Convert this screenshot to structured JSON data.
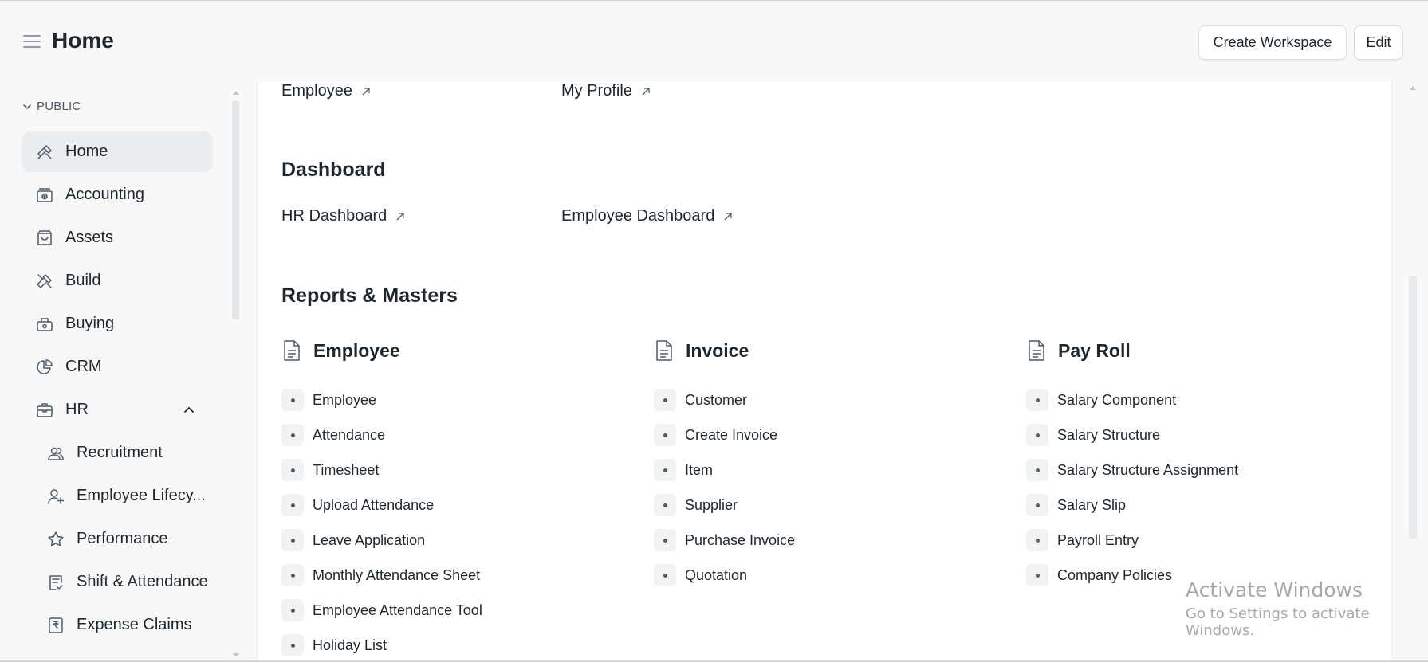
{
  "header": {
    "title": "Home",
    "create_workspace": "Create Workspace",
    "edit": "Edit"
  },
  "sidebar": {
    "section": "PUBLIC",
    "items": [
      {
        "label": "Home",
        "icon": "tools-icon"
      },
      {
        "label": "Accounting",
        "icon": "accounting-icon"
      },
      {
        "label": "Assets",
        "icon": "bag-icon"
      },
      {
        "label": "Build",
        "icon": "hammer-icon"
      },
      {
        "label": "Buying",
        "icon": "buying-icon"
      },
      {
        "label": "CRM",
        "icon": "pie-chart-icon"
      },
      {
        "label": "HR",
        "icon": "briefcase-icon"
      },
      {
        "label": "Recruitment",
        "icon": "users-icon"
      },
      {
        "label": "Employee Lifecy...",
        "icon": "user-plus-icon"
      },
      {
        "label": "Performance",
        "icon": "star-icon"
      },
      {
        "label": "Shift & Attendance",
        "icon": "clipboard-check-icon"
      },
      {
        "label": "Expense Claims",
        "icon": "rupee-receipt-icon"
      }
    ]
  },
  "main": {
    "top_links": [
      "Employee",
      "My Profile"
    ],
    "dashboard": {
      "title": "Dashboard",
      "links": [
        "HR Dashboard",
        "Employee Dashboard"
      ]
    },
    "reports": {
      "title": "Reports & Masters",
      "cards": [
        {
          "title": "Employee",
          "items": [
            "Employee",
            "Attendance",
            "Timesheet",
            "Upload Attendance",
            "Leave Application",
            "Monthly Attendance Sheet",
            "Employee Attendance Tool",
            "Holiday List"
          ]
        },
        {
          "title": "Invoice",
          "items": [
            "Customer",
            "Create Invoice",
            "Item",
            "Supplier",
            "Purchase Invoice",
            "Quotation"
          ]
        },
        {
          "title": "Pay Roll",
          "items": [
            "Salary Component",
            "Salary Structure",
            "Salary Structure Assignment",
            "Salary Slip",
            "Payroll Entry",
            "Company Policies"
          ]
        }
      ]
    }
  },
  "watermark": {
    "line1": "Activate Windows",
    "line2": "Go to Settings to activate Windows."
  }
}
